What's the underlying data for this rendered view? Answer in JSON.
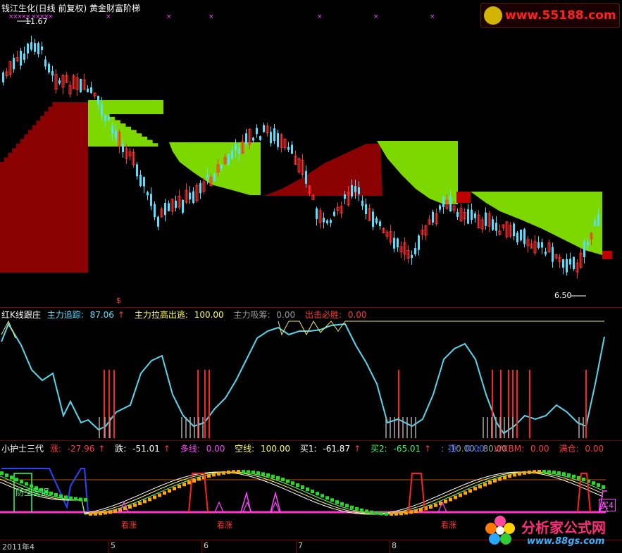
{
  "window": {
    "title": "钱江生化(日线 前复权) 黄金财富阶梯",
    "high_marker": "11.67",
    "low_marker": "6.50",
    "signal_glyph": "$"
  },
  "panel2": {
    "title": "红K线跟庄",
    "items": [
      {
        "label": "主力追踪:",
        "value": "87.06",
        "arrow": "↑",
        "color": "cyan"
      },
      {
        "label": "主力拉高出逃:",
        "value": "100.00",
        "arrow": "",
        "color": "yellow"
      },
      {
        "label": "主力吸筹:",
        "value": "0.00",
        "arrow": "",
        "color": "gray"
      },
      {
        "label": "出击必胜:",
        "value": "0.00",
        "arrow": "",
        "color": "red"
      }
    ]
  },
  "panel3": {
    "title": "小护士三代",
    "items": [
      {
        "label": "涨:",
        "value": "-27.96",
        "arrow": "↑",
        "color": "red"
      },
      {
        "label": "跌:",
        "value": "-51.01",
        "arrow": "↑",
        "color": "white"
      },
      {
        "label": "多线:",
        "value": "0.00",
        "arrow": "",
        "color": "magenta"
      },
      {
        "label": "空线:",
        "value": "100.00",
        "arrow": "",
        "color": "yellow"
      },
      {
        "label": "买1:",
        "value": "-61.87",
        "arrow": "↑",
        "color": "white"
      },
      {
        "label": "买2:",
        "value": "-65.01",
        "arrow": "↑",
        "color": "green"
      },
      {
        "label": ":",
        "value": "-10.00 : 80.00",
        "arrow": "",
        "color": "gray"
      },
      {
        "label": "顶:",
        "value": "0.00",
        "arrow": "",
        "color": "blue"
      },
      {
        "label": "WXBM:",
        "value": "0.00",
        "arrow": "",
        "color": "red"
      },
      {
        "label": "满仓:",
        "value": "0.00",
        "arrow": "",
        "color": "red"
      }
    ],
    "warning_label": "防空警报",
    "watch_label": "看涨",
    "buy_label": "买4"
  },
  "xaxis": {
    "labels": [
      "2011年4",
      "5",
      "6",
      "7",
      "8"
    ]
  },
  "watermark": {
    "top_url": "www.55188.com",
    "site_name": "分析家公式网",
    "site_url": "www.88gs.com"
  },
  "colors": {
    "bull_candle": "#ff3030",
    "bear_candle": "#54e0ff",
    "ladder_red": "#8b0000",
    "ladder_green": "#7dd800",
    "cyan_line": "#55d8ee",
    "yellow_line": "#f0e86a"
  }
}
